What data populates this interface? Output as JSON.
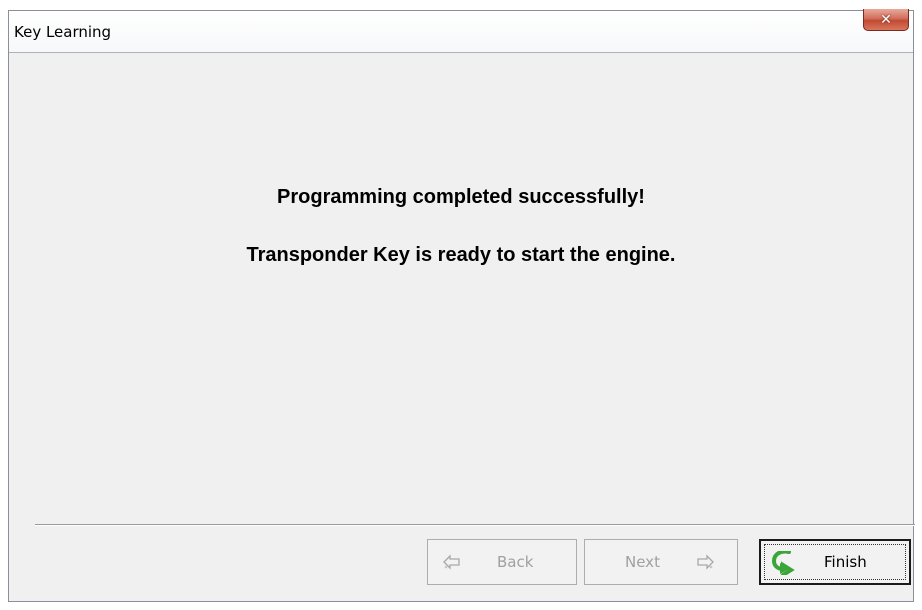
{
  "window": {
    "title": "Key Learning",
    "close_symbol": "✕"
  },
  "message": {
    "line1": "Programming completed successfully!",
    "line2": "Transponder Key is ready to start the engine."
  },
  "buttons": {
    "back": {
      "label": "Back",
      "icon": "back-arrow-icon",
      "enabled": false
    },
    "next": {
      "label": "Next",
      "icon": "next-arrow-icon",
      "enabled": false
    },
    "finish": {
      "label": "Finish",
      "icon": "finish-arrow-icon",
      "enabled": true
    }
  },
  "colors": {
    "window_bg": "#f0f0f0",
    "close_button": "#c24a33",
    "finish_icon": "#3aa63a",
    "disabled_text": "#a0a0a0"
  }
}
